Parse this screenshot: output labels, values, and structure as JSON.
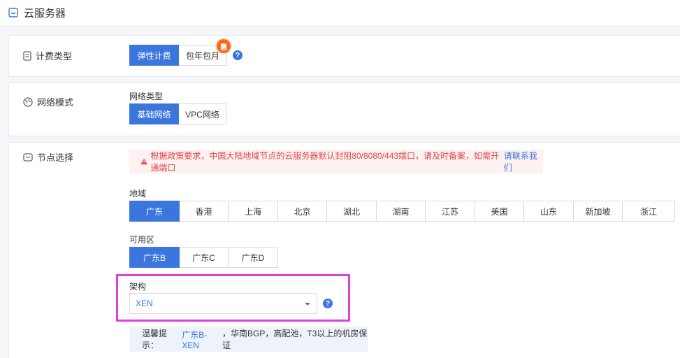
{
  "header": {
    "title": "云服务器"
  },
  "billing": {
    "label": "计费类型",
    "options": [
      "弹性计费",
      "包年包月"
    ],
    "selected": "弹性计费",
    "badge": "惠"
  },
  "network": {
    "label": "网络模式",
    "field_label": "网络类型",
    "options": [
      "基础网络",
      "VPC网络"
    ],
    "selected": "基础网络"
  },
  "node": {
    "label": "节点选择",
    "warning": {
      "text": "根据政策要求，中国大陆地域节点的云服务器默认封阻80/8080/443端口，请及时备案，如需开通端口",
      "link": "请联系我们"
    },
    "region_label": "地域",
    "regions": [
      "广东",
      "香港",
      "上海",
      "北京",
      "湖北",
      "湖南",
      "江苏",
      "美国",
      "山东",
      "新加坡",
      "浙江"
    ],
    "region_selected": "广东",
    "zone_label": "可用区",
    "zones": [
      "广东B",
      "广东C",
      "广东D"
    ],
    "zone_selected": "广东B",
    "arch_label": "架构",
    "arch_value": "XEN",
    "tip": {
      "prefix": "温馨提示：",
      "highlight": "广东B-XEN",
      "rest": "，华南BGP，高配池，T3以上的机房保证"
    }
  },
  "colors": {
    "accent": "#3a76de",
    "warning": "#e04747",
    "badge": "#f56b1e",
    "highlight_box": "#e03ee0"
  }
}
